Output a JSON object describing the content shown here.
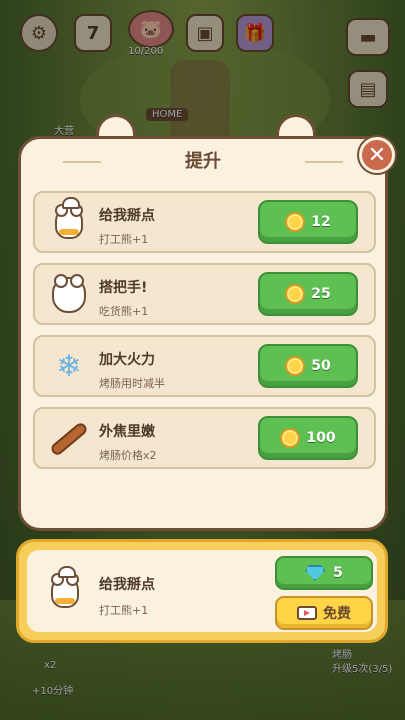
{
  "hud": {
    "calendar_day": "7",
    "capacity": "10/200",
    "home_label": "HOME",
    "left_label": "大营"
  },
  "panel": {
    "title": "提升",
    "rows": [
      {
        "name": "给我掰点",
        "desc": "打工熊+1",
        "cost": "12",
        "icon": "chef-bear-icon"
      },
      {
        "name": "搭把手!",
        "desc": "吃货熊+1",
        "cost": "25",
        "icon": "bear-icon"
      },
      {
        "name": "加大火力",
        "desc": "烤肠用时减半",
        "cost": "50",
        "icon": "snowflake-clock-icon"
      },
      {
        "name": "外焦里嫩",
        "desc": "烤肠价格x2",
        "cost": "100",
        "icon": "sausage-icon"
      }
    ]
  },
  "offer": {
    "name": "给我掰点",
    "desc": "打工熊+1",
    "gem_cost": "5",
    "free_label": "免费"
  },
  "bottom": {
    "multiplier": "x2",
    "timer": "+10分钟",
    "sausage_title": "烤肠",
    "upgrade_text": "升级5次(3/5)"
  },
  "colors": {
    "panel_bg": "#fbf1df",
    "border": "#6d4e36",
    "green_button": "#5ec053",
    "yellow_button": "#ffd447",
    "close_button": "#c96a4d"
  }
}
